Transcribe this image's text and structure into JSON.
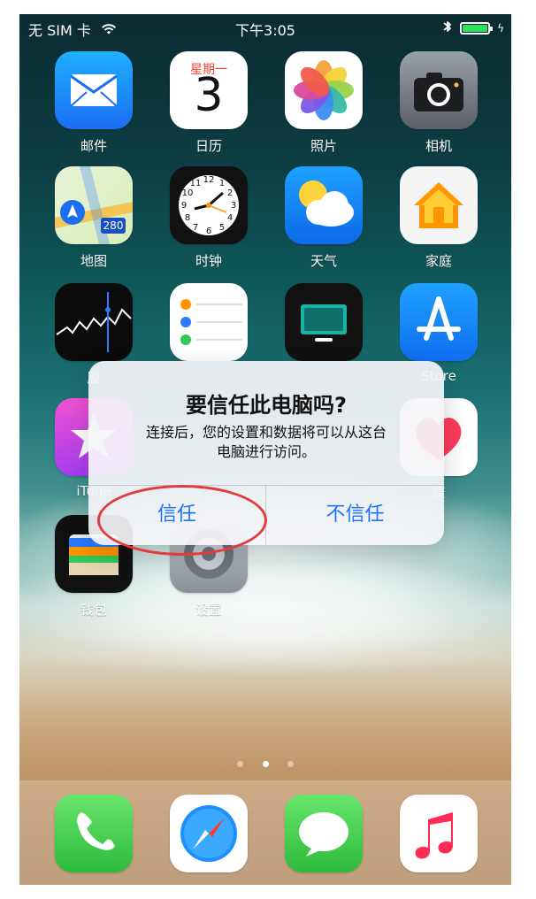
{
  "status_bar": {
    "carrier": "无 SIM 卡",
    "time": "下午3:05",
    "bluetooth": "bluetooth-icon",
    "charging": "bolt-icon"
  },
  "apps": {
    "row1": [
      {
        "label": "邮件",
        "icon": "mail-icon"
      },
      {
        "label": "日历",
        "icon": "calendar-icon",
        "weekday": "星期一",
        "day": "3"
      },
      {
        "label": "照片",
        "icon": "photos-icon"
      },
      {
        "label": "相机",
        "icon": "camera-icon"
      }
    ],
    "row2": [
      {
        "label": "地图",
        "icon": "maps-icon",
        "route": "280"
      },
      {
        "label": "时钟",
        "icon": "clock-icon"
      },
      {
        "label": "天气",
        "icon": "weather-icon"
      },
      {
        "label": "家庭",
        "icon": "home-icon"
      }
    ],
    "row3": [
      {
        "label": "股",
        "icon": "stocks-icon"
      },
      {
        "label": "",
        "icon": "reminders-icon"
      },
      {
        "label": "",
        "icon": "tv-icon"
      },
      {
        "label": "Store",
        "icon": "appstore-icon"
      }
    ],
    "row4": [
      {
        "label": "iTune",
        "icon": "itunes-icon"
      },
      {
        "label": "",
        "icon": "settings-icon"
      },
      {
        "label": "",
        "icon": "settings-icon"
      },
      {
        "label": "康",
        "icon": "health-icon"
      }
    ],
    "row5": [
      {
        "label": "钱包",
        "icon": "wallet-icon"
      },
      {
        "label": "设置",
        "icon": "settings-icon"
      }
    ]
  },
  "page_dots": {
    "count": 3,
    "active_index": 1
  },
  "dock": [
    {
      "name": "phone",
      "icon": "phone-icon"
    },
    {
      "name": "safari",
      "icon": "safari-icon"
    },
    {
      "name": "messages",
      "icon": "messages-icon"
    },
    {
      "name": "music",
      "icon": "music-icon"
    }
  ],
  "dialog": {
    "title": "要信任此电脑吗?",
    "message_line1": "连接后，您的设置和数据将可以从这台",
    "message_line2": "电脑进行访问。",
    "trust_label": "信任",
    "distrust_label": "不信任"
  },
  "colors": {
    "button_blue": "#1a74ff",
    "highlight_red": "#e23c3c"
  }
}
